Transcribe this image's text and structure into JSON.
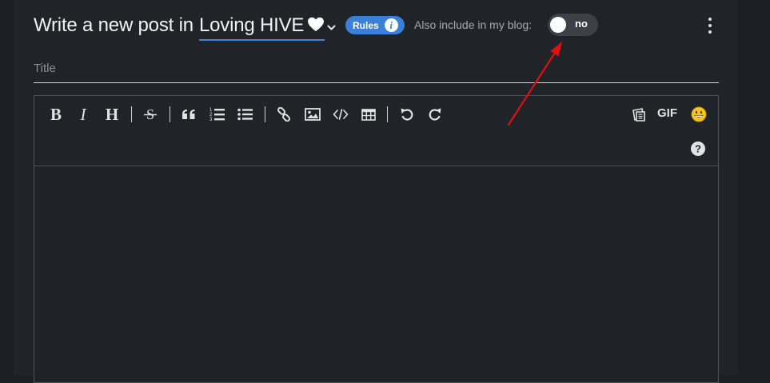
{
  "header": {
    "heading": "Write a new post in",
    "community": "Loving HIVE",
    "rules_label": "Rules",
    "also_include_label": "Also include in my blog:",
    "toggle_state": "no"
  },
  "title_field": {
    "placeholder": "Title",
    "value": ""
  },
  "toolbar": {
    "bold": "B",
    "italic": "I",
    "heading": "H",
    "gif": "GIF"
  },
  "icons": [
    "heart-icon",
    "chevron-down-icon",
    "info-icon",
    "kebab-menu-icon",
    "bold-icon",
    "italic-icon",
    "heading-icon",
    "strikethrough-icon",
    "quote-icon",
    "ordered-list-icon",
    "unordered-list-icon",
    "link-icon",
    "image-icon",
    "code-icon",
    "table-icon",
    "undo-icon",
    "redo-icon",
    "snippets-icon",
    "gif-icon",
    "emoji-icon",
    "help-icon"
  ],
  "colors": {
    "panel_background": "#202327",
    "page_background": "#1b1e22",
    "accent_blue": "#3a80d8",
    "annotation_arrow": "#e01010"
  }
}
